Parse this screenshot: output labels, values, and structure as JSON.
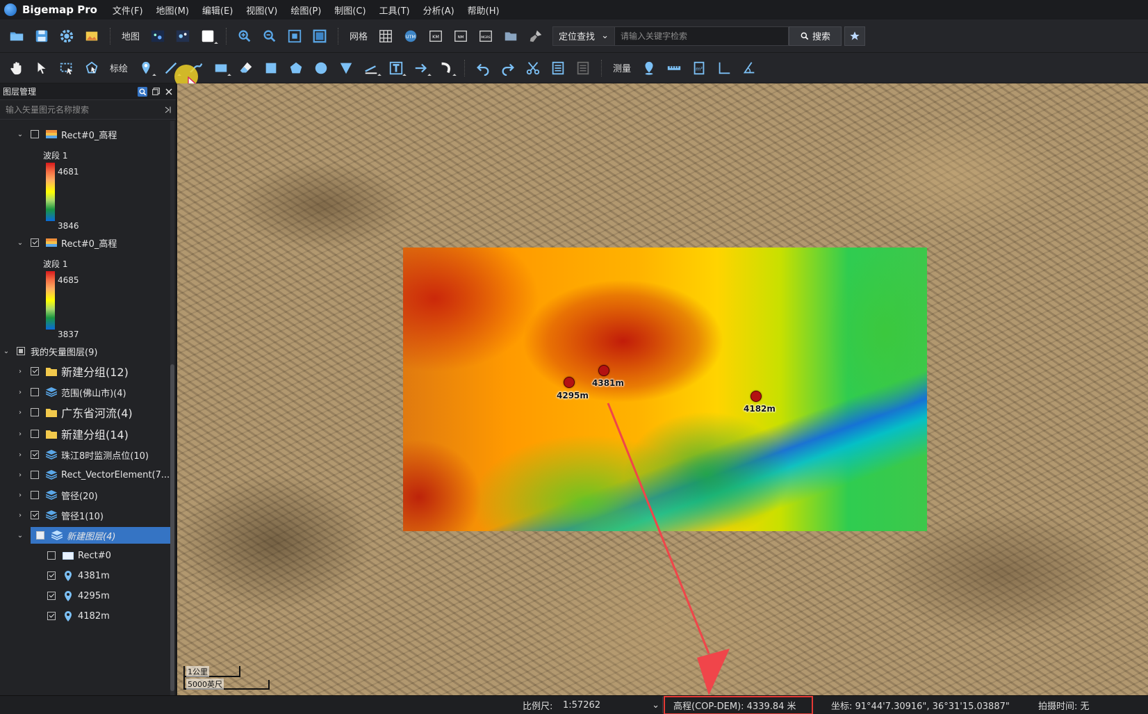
{
  "app": {
    "title": "Bigemap Pro"
  },
  "menu": [
    "文件(F)",
    "地图(M)",
    "编辑(E)",
    "视图(V)",
    "绘图(P)",
    "制图(C)",
    "工具(T)",
    "分析(A)",
    "帮助(H)"
  ],
  "toolbar1": {
    "map_label": "地图",
    "grid_label": "网格",
    "locate_select": "定位查找",
    "search_placeholder": "请输入关键字检索",
    "search_button": "搜索"
  },
  "toolbar2": {
    "draw_label": "标绘",
    "measure_label": "测量"
  },
  "layer_panel": {
    "title": "图层管理",
    "search_placeholder": "输入矢量图元名称搜索",
    "rows": [
      {
        "label": "Rect#0_高程",
        "checked": false,
        "expanded": true,
        "icon": "raster-icon"
      },
      {
        "label": "Rect#0_高程",
        "checked": true,
        "expanded": true,
        "icon": "raster-icon"
      },
      {
        "label": "我的矢量图层(9)",
        "checked": false,
        "expanded": true,
        "icon": "none"
      },
      {
        "label": "新建分组(12)",
        "checked": true,
        "expanded": false,
        "icon": "folder-icon"
      },
      {
        "label": "范围(佛山市)(4)",
        "checked": false,
        "expanded": false,
        "icon": "layers-icon"
      },
      {
        "label": "广东省河流(4)",
        "checked": false,
        "expanded": false,
        "icon": "folder-icon"
      },
      {
        "label": "新建分组(14)",
        "checked": false,
        "expanded": false,
        "icon": "folder-icon"
      },
      {
        "label": "珠江8时监测点位(10)",
        "checked": true,
        "expanded": false,
        "icon": "layers-icon"
      },
      {
        "label": "Rect_VectorElement(7...",
        "checked": false,
        "expanded": false,
        "icon": "layers-icon"
      },
      {
        "label": "管径(20)",
        "checked": false,
        "expanded": false,
        "icon": "layers-icon"
      },
      {
        "label": "管径1(10)",
        "checked": true,
        "expanded": false,
        "icon": "layers-icon"
      },
      {
        "label": "新建图层(4)",
        "checked": false,
        "expanded": true,
        "icon": "layers-icon",
        "selected": true
      },
      {
        "label": "Rect#0",
        "checked": false,
        "icon": "rect-icon"
      },
      {
        "label": "4381m",
        "checked": true,
        "icon": "pin-icon"
      },
      {
        "label": "4295m",
        "checked": true,
        "icon": "pin-icon"
      },
      {
        "label": "4182m",
        "checked": true,
        "icon": "pin-icon"
      }
    ],
    "legends": [
      {
        "band": "波段 1",
        "max": "4681",
        "min": "3846"
      },
      {
        "band": "波段 1",
        "max": "4685",
        "min": "3837"
      }
    ]
  },
  "map": {
    "markers": [
      {
        "label": "4295m"
      },
      {
        "label": "4381m"
      },
      {
        "label": "4182m"
      }
    ],
    "scale_bar": {
      "km": "1公里",
      "ft": "5000英尺"
    }
  },
  "statusbar": {
    "scale_label": "比例尺:",
    "scale_value": "1:57262",
    "elevation": "高程(COP-DEM): 4339.84 米",
    "coordinate": "坐标: 91°44'7.30916\", 36°31'15.03887\"",
    "capture_time": "拍摄时间: 无"
  },
  "colors": {
    "accent": "#3574c4",
    "highlight": "#e53935",
    "marker": "#b31212"
  }
}
